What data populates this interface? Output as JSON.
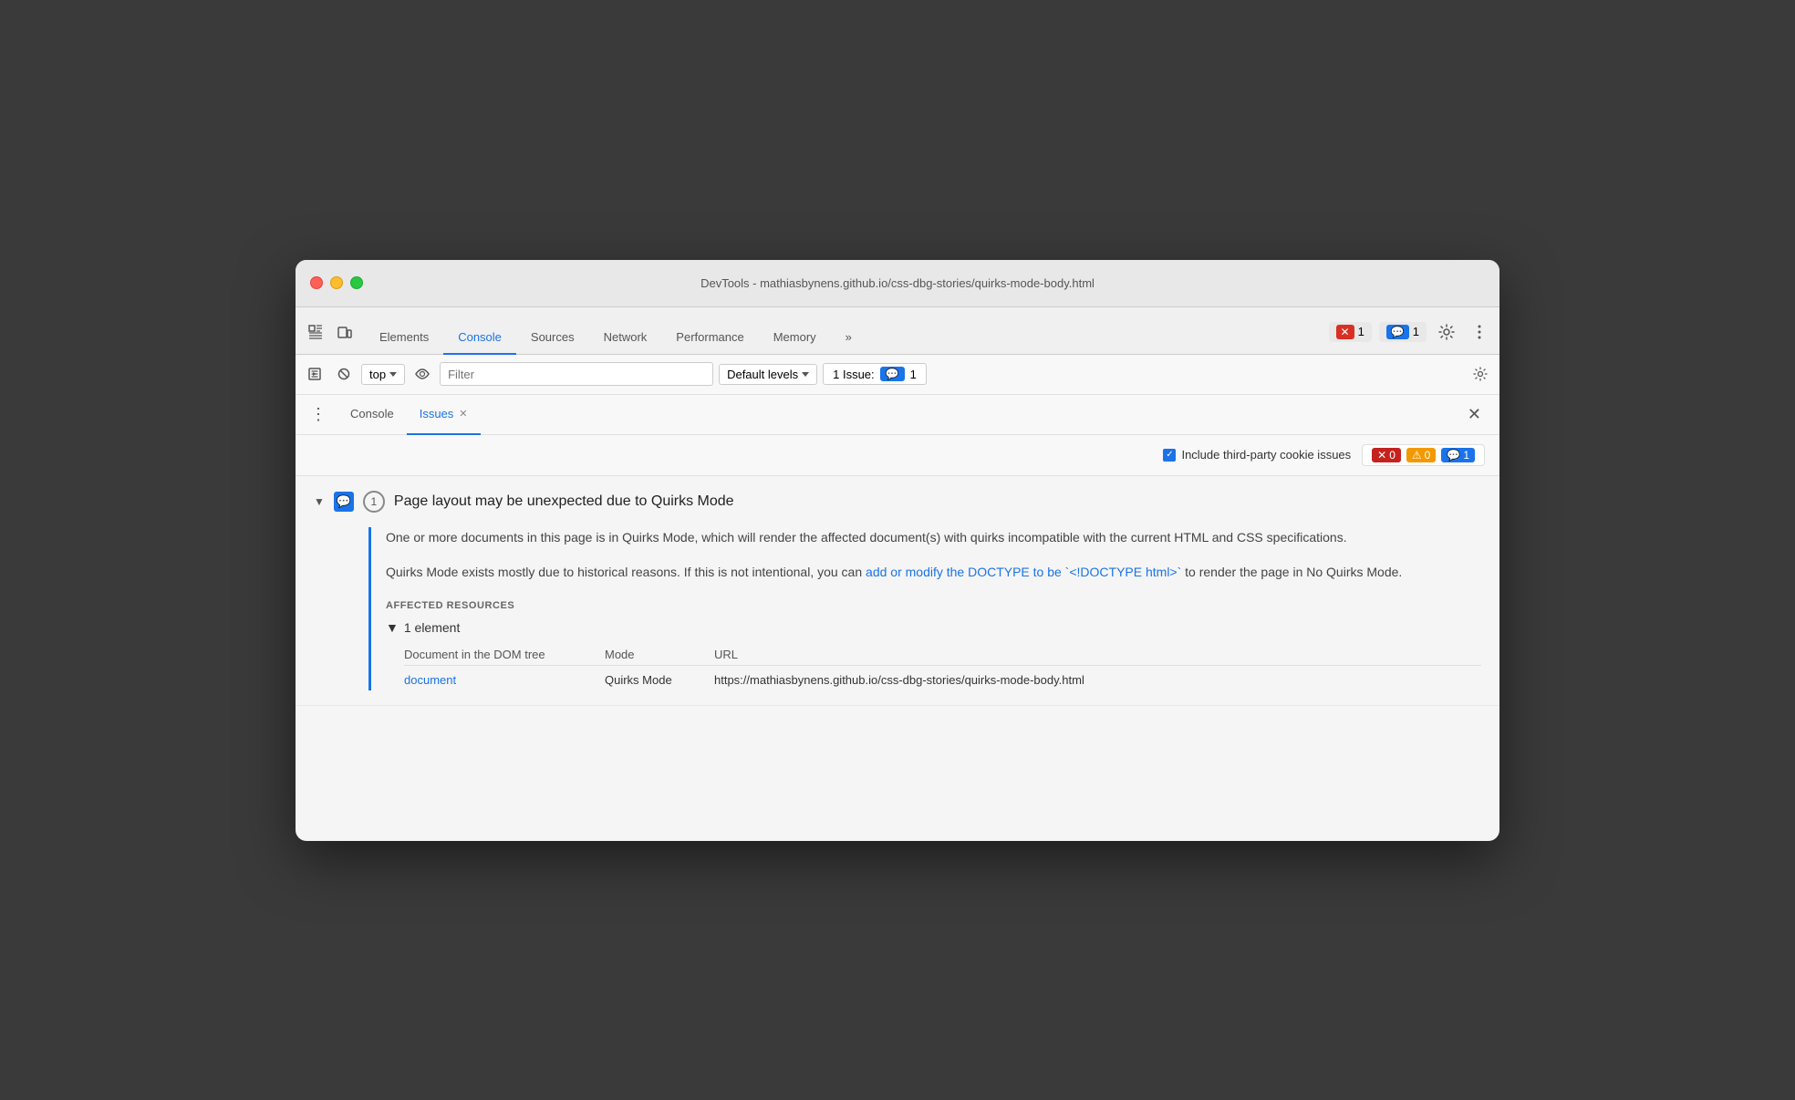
{
  "window": {
    "title": "DevTools - mathiasbynens.github.io/css-dbg-stories/quirks-mode-body.html"
  },
  "tabs": {
    "items": [
      {
        "label": "Elements",
        "active": false
      },
      {
        "label": "Console",
        "active": true
      },
      {
        "label": "Sources",
        "active": false
      },
      {
        "label": "Network",
        "active": false
      },
      {
        "label": "Performance",
        "active": false
      },
      {
        "label": "Memory",
        "active": false
      },
      {
        "label": "»",
        "active": false
      }
    ],
    "error_count": "1",
    "message_count": "1"
  },
  "console_toolbar": {
    "top_label": "top",
    "filter_placeholder": "Filter",
    "levels_label": "Default levels",
    "issue_label": "1 Issue:",
    "issue_count": "1"
  },
  "panel": {
    "tabs": [
      {
        "label": "Console",
        "active": false,
        "closeable": false
      },
      {
        "label": "Issues",
        "active": true,
        "closeable": true
      }
    ]
  },
  "issues_filter": {
    "checkbox_label": "Include third-party cookie issues",
    "error_count": "0",
    "warning_count": "0",
    "info_count": "1"
  },
  "issue": {
    "title": "Page layout may be unexpected due to Quirks Mode",
    "count": "1",
    "description1": "One or more documents in this page is in Quirks Mode, which will render the affected document(s) with quirks incompatible with the current HTML and CSS specifications.",
    "description2_before": "Quirks Mode exists mostly due to historical reasons. If this is not intentional, you can ",
    "description2_link": "add or modify the DOCTYPE to be `<!DOCTYPE html>`",
    "description2_after": " to render the page in No Quirks Mode.",
    "affected_label": "AFFECTED RESOURCES",
    "element_count": "1 element",
    "col1_header": "Document in the DOM tree",
    "col2_header": "Mode",
    "col3_header": "URL",
    "row_link": "document",
    "row_mode": "Quirks Mode",
    "row_url": "https://mathiasbynens.github.io/css-dbg-stories/quirks-mode-body.html"
  }
}
